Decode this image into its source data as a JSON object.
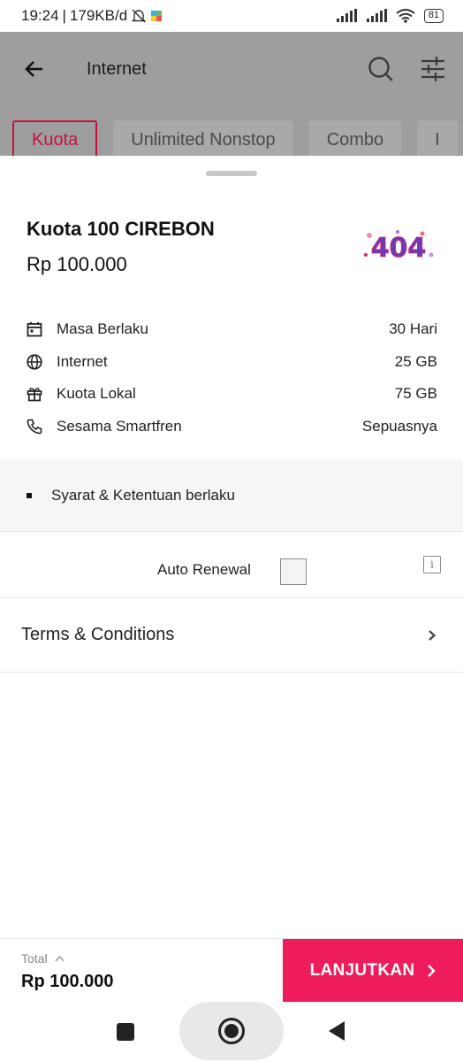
{
  "status_bar": {
    "time": "19:24",
    "network_speed": "179KB/d",
    "battery": "81"
  },
  "header": {
    "title": "Internet"
  },
  "tabs": [
    {
      "label": "Kuota"
    },
    {
      "label": "Unlimited Nonstop"
    },
    {
      "label": "Combo"
    },
    {
      "label": "I"
    }
  ],
  "package": {
    "name": "Kuota 100 CIREBON",
    "price": "Rp 100.000",
    "logo_text": "404",
    "details": [
      {
        "label": "Masa Berlaku",
        "value": "30 Hari",
        "icon": "calendar-icon"
      },
      {
        "label": "Internet",
        "value": "25 GB",
        "icon": "globe-icon"
      },
      {
        "label": "Kuota Lokal",
        "value": "75 GB",
        "icon": "gift-icon"
      },
      {
        "label": "Sesama Smartfren",
        "value": "Sepuasnya",
        "icon": "phone-icon"
      }
    ],
    "note": "Syarat & Ketentuan berlaku"
  },
  "auto_renewal": {
    "label": "Auto Renewal",
    "checked": false
  },
  "terms": {
    "label": "Terms & Conditions"
  },
  "footer": {
    "total_label": "Total",
    "total_value": "Rp 100.000",
    "cta_label": "LANJUTKAN"
  },
  "colors": {
    "accent": "#ee1c5a",
    "tab_active": "#c8103e",
    "overlay": "#9e9e9e"
  }
}
